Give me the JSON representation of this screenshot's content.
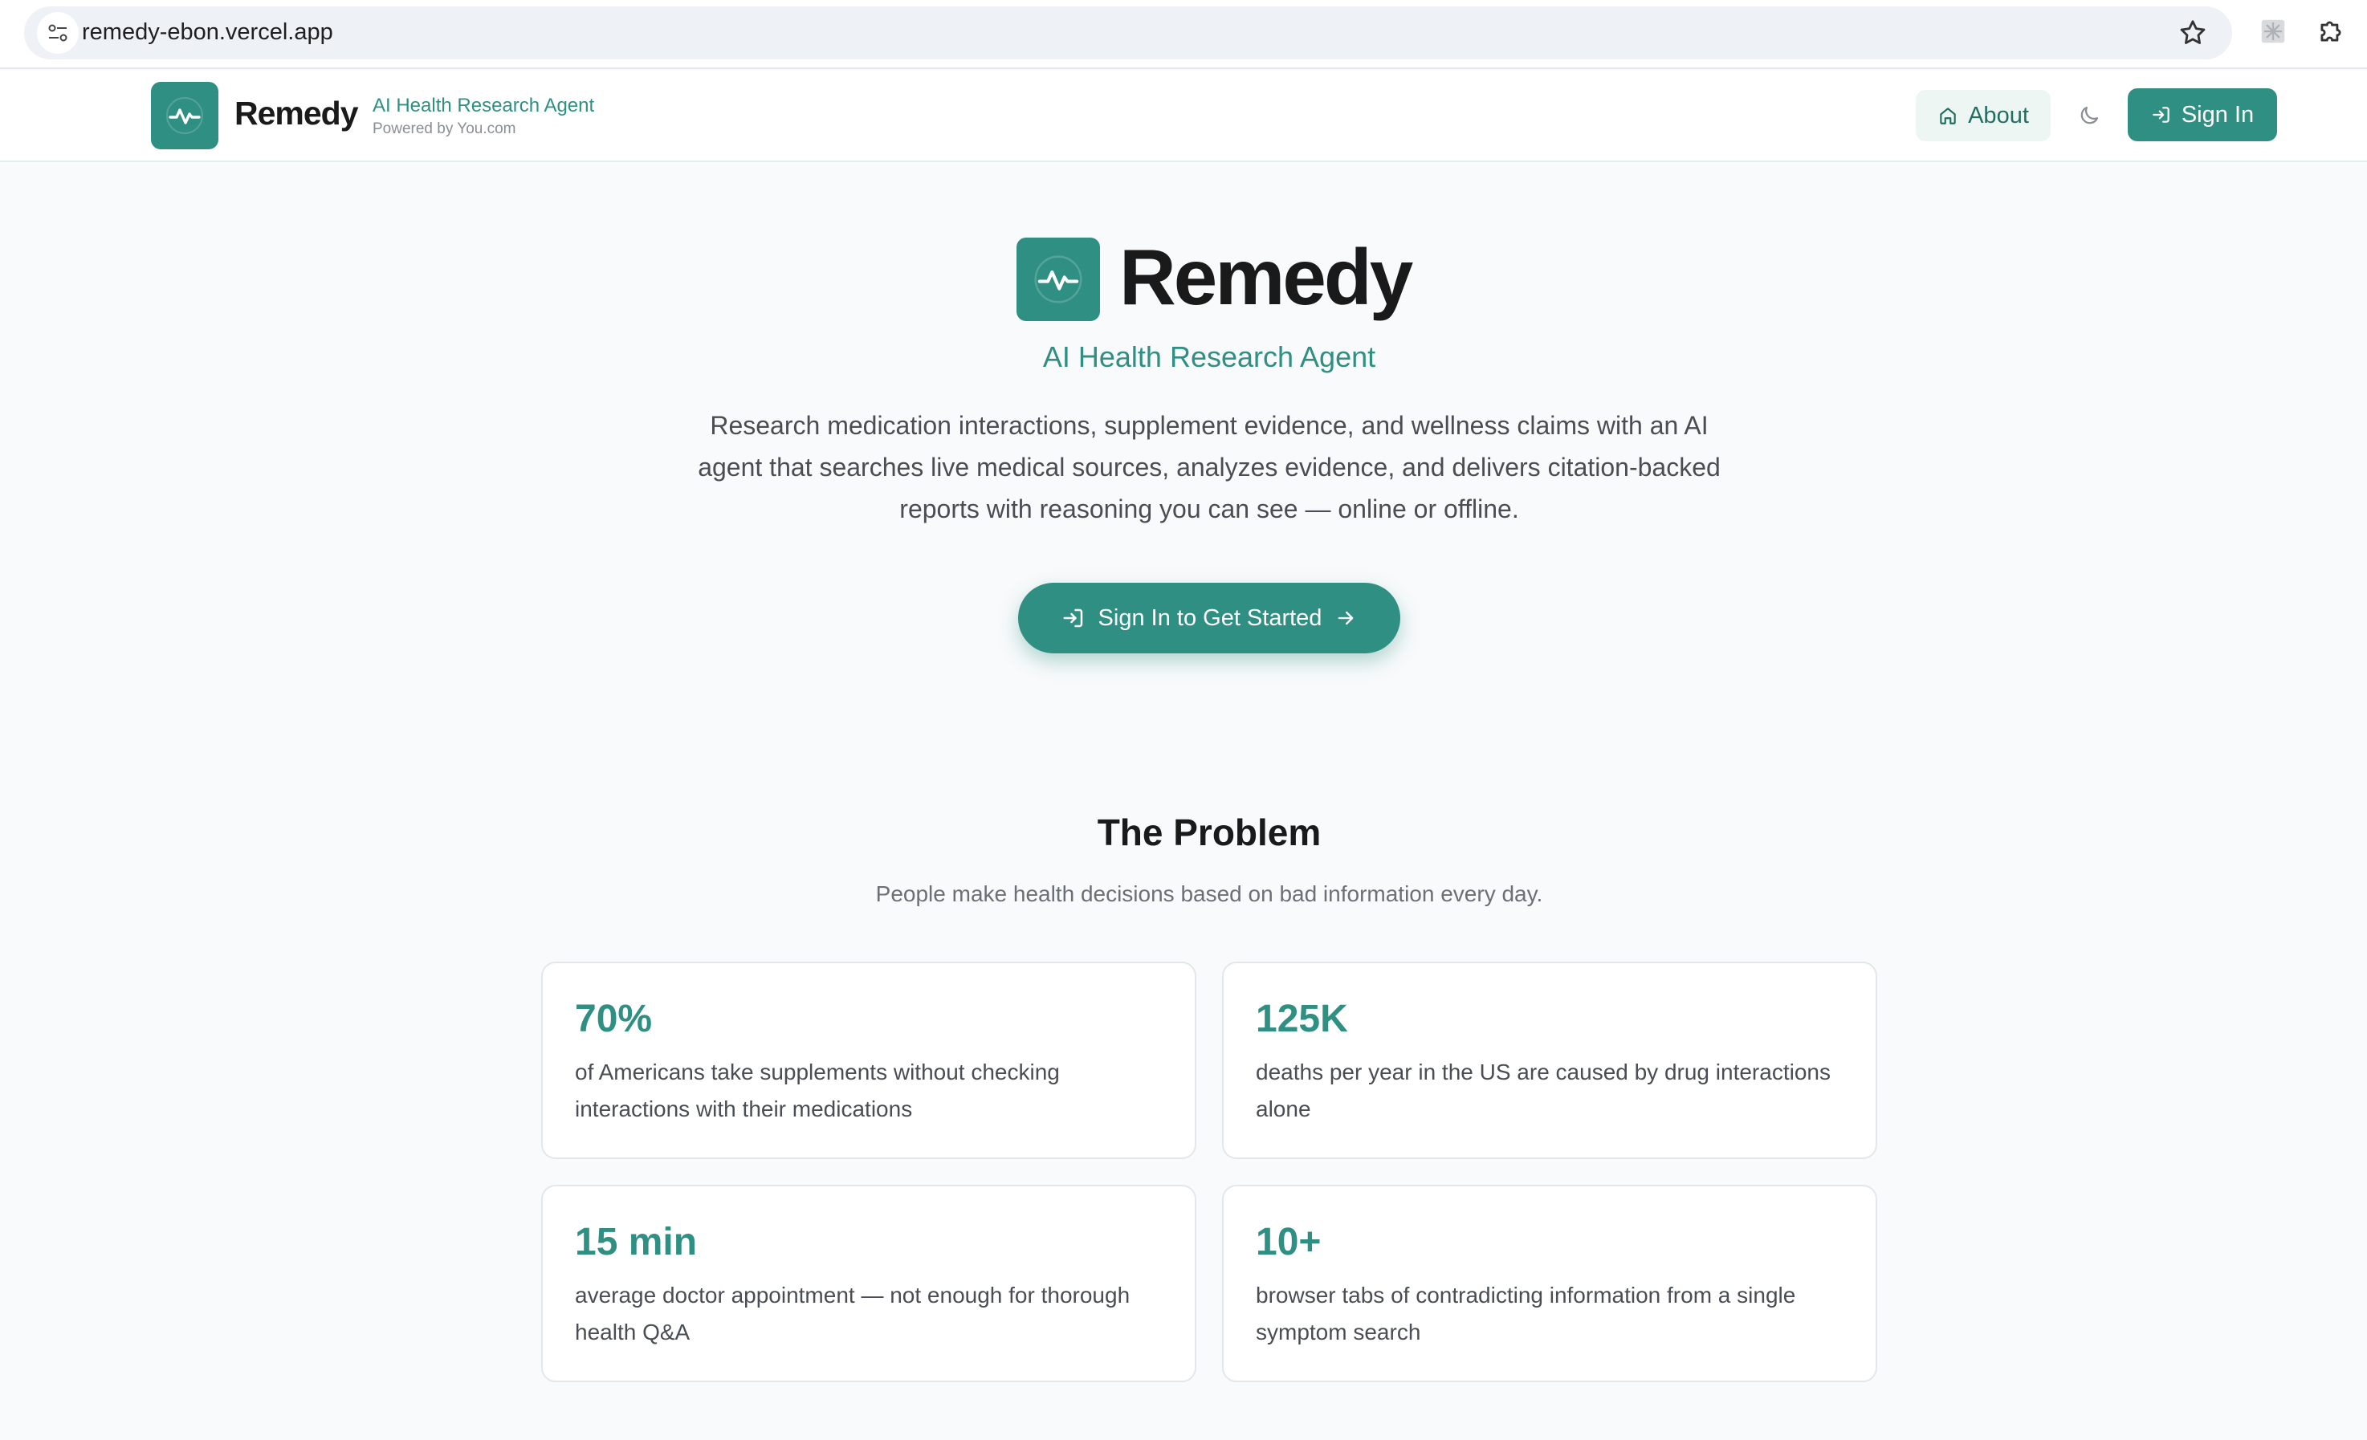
{
  "browser": {
    "url": "remedy-ebon.vercel.app"
  },
  "header": {
    "brand": "Remedy",
    "tagline": "AI Health Research Agent",
    "powered_by": "Powered by You.com",
    "about_label": "About",
    "signin_label": "Sign In"
  },
  "hero": {
    "title": "Remedy",
    "subtitle": "AI Health Research Agent",
    "description": "Research medication interactions, supplement evidence, and wellness claims with an AI agent that searches live medical sources, analyzes evidence, and delivers citation-backed reports with reasoning you can see — online or offline.",
    "cta_label": "Sign In to Get Started"
  },
  "problem": {
    "title": "The Problem",
    "subtitle": "People make health decisions based on bad information every day.",
    "cards": [
      {
        "stat": "70%",
        "text": "of Americans take supplements without checking interactions with their medications"
      },
      {
        "stat": "125K",
        "text": "deaths per year in the US are caused by drug interactions alone"
      },
      {
        "stat": "15 min",
        "text": "average doctor appointment — not enough for thorough health Q&A"
      },
      {
        "stat": "10+",
        "text": "browser tabs of contradicting information from a single symptom search"
      }
    ]
  },
  "colors": {
    "accent": "#2f8f82",
    "background": "#f8fafb",
    "text": "#1a1a1a"
  },
  "icons": [
    "tune-icon",
    "star-icon",
    "extension-puzzle-icon",
    "pulse-icon",
    "home-icon",
    "moon-icon",
    "sign-in-icon",
    "arrow-right-icon"
  ]
}
